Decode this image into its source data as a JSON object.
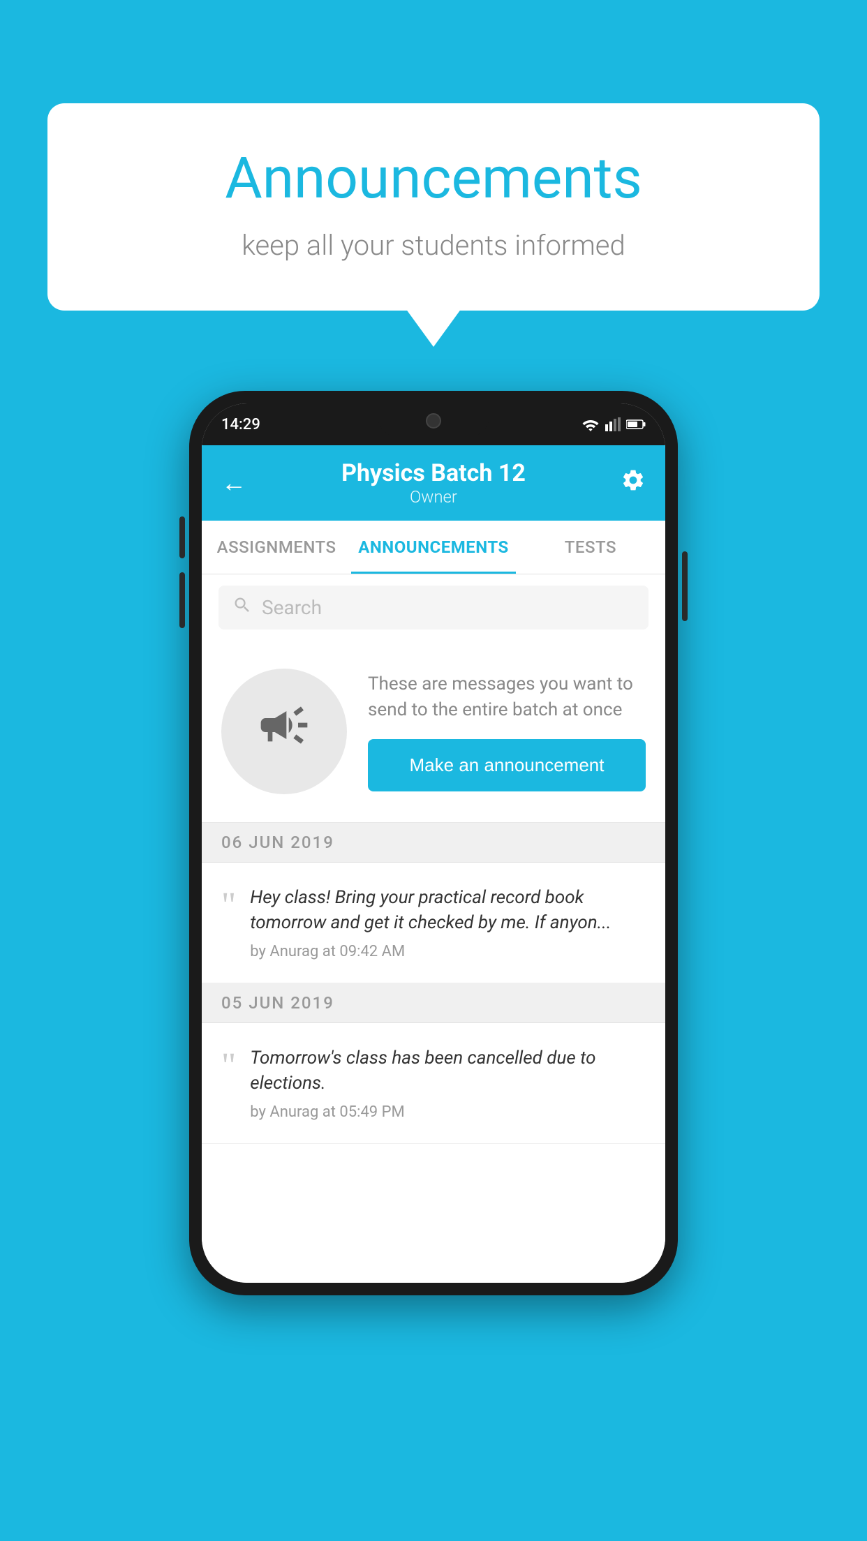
{
  "background_color": "#1bb8e0",
  "speech_bubble": {
    "title": "Announcements",
    "subtitle": "keep all your students informed"
  },
  "phone": {
    "status_bar": {
      "time": "14:29"
    },
    "header": {
      "title": "Physics Batch 12",
      "subtitle": "Owner",
      "back_label": "←"
    },
    "tabs": [
      {
        "label": "ASSIGNMENTS",
        "active": false
      },
      {
        "label": "ANNOUNCEMENTS",
        "active": true
      },
      {
        "label": "TESTS",
        "active": false
      }
    ],
    "search": {
      "placeholder": "Search"
    },
    "announcement_prompt": {
      "description": "These are messages you want to send to the entire batch at once",
      "button_label": "Make an announcement"
    },
    "announcements": [
      {
        "date": "06  JUN  2019",
        "text": "Hey class! Bring your practical record book tomorrow and get it checked by me. If anyon...",
        "meta": "by Anurag at 09:42 AM"
      },
      {
        "date": "05  JUN  2019",
        "text": "Tomorrow's class has been cancelled due to elections.",
        "meta": "by Anurag at 05:49 PM"
      }
    ]
  }
}
